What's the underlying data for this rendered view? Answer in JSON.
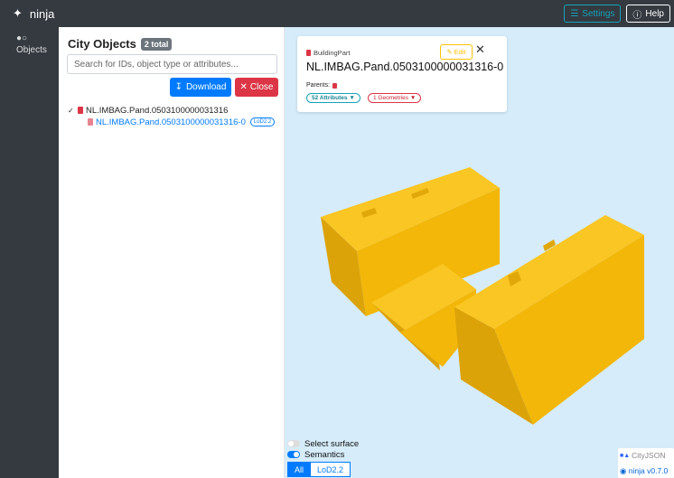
{
  "app": {
    "name": "ninja"
  },
  "navbar": {
    "settings_label": "Settings",
    "help_label": "Help"
  },
  "rail": {
    "objects_label": "Objects"
  },
  "objects_panel": {
    "title": "City Objects",
    "total_badge": "2 total",
    "search_placeholder": "Search for IDs, object type or attributes...",
    "download_label": "Download",
    "close_label": "Close",
    "tree": {
      "parent_id": "NL.IMBAG.Pand.0503100000031316",
      "child_id": "NL.IMBAG.Pand.0503100000031316-0",
      "child_lod": "LoD2.2"
    }
  },
  "info_card": {
    "type": "BuildingPart",
    "object_id": "NL.IMBAG.Pand.0503100000031316-0",
    "parents_label": "Parents:",
    "edit_label": "Edit",
    "attributes_pill": "52 Attributes",
    "geometries_pill": "1 Geometries"
  },
  "viewer_controls": {
    "select_surface_label": "Select surface",
    "select_surface_on": false,
    "semantics_label": "Semantics",
    "semantics_on": true,
    "lod_tabs": [
      "All",
      "LoD2.2"
    ],
    "active_lod": "All"
  },
  "footer_badge": {
    "cityjson_label": "CityJSON",
    "version_label": "ninja v0.7.0"
  },
  "colors": {
    "navbar_bg": "#343a40",
    "viewer_bg": "#d6ecfa",
    "building_top": "#f9c624",
    "building_side_light": "#f2b708",
    "building_side_dark": "#dca309",
    "primary": "#007bff",
    "danger": "#dc3545",
    "info": "#17a2b8",
    "warning": "#ffc107"
  }
}
